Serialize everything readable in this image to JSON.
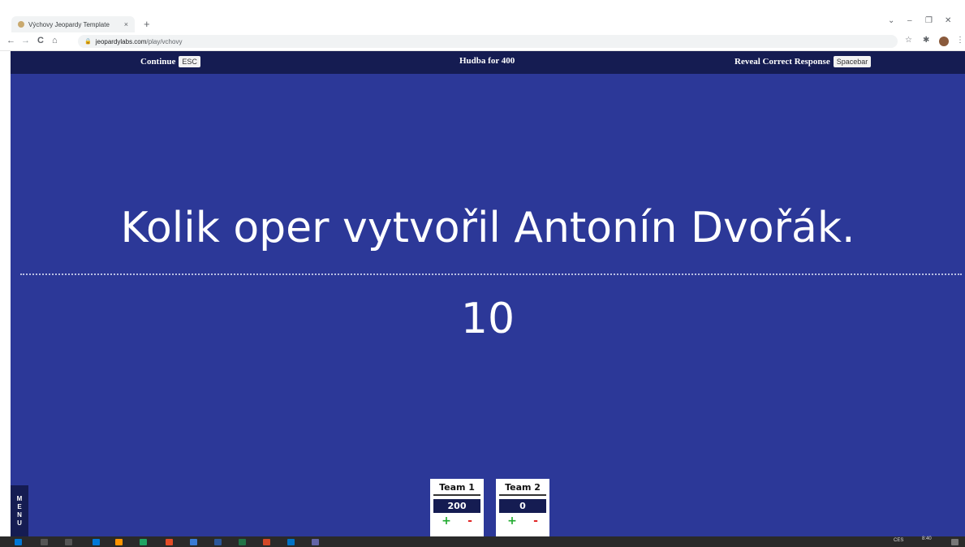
{
  "browser": {
    "tab_title": "Výchovy Jeopardy Template",
    "tab_close": "×",
    "new_tab": "+",
    "url_host": "jeopardylabs.com",
    "url_path": "/play/vchovy",
    "lock": "🔒",
    "back": "←",
    "forward": "→",
    "reload": "C",
    "home": "⌂",
    "star": "☆",
    "extensions": "✱",
    "more": "⋮",
    "window_controls": {
      "chevron": "⌄",
      "minimize": "–",
      "restore": "❐",
      "close": "✕"
    }
  },
  "game": {
    "continue_label": "Continue",
    "continue_key": "ESC",
    "category_title": "Hudba for 400",
    "reveal_label": "Reveal Correct Response",
    "reveal_key": "Spacebar",
    "question": "Kolik oper vytvořil Antonín Dvořák.",
    "answer": "10",
    "menu_letters": [
      "M",
      "E",
      "N",
      "U"
    ]
  },
  "teams": [
    {
      "name": "Team 1",
      "score": "200",
      "plus": "+",
      "minus": "-"
    },
    {
      "name": "Team 2",
      "score": "0",
      "plus": "+",
      "minus": "-"
    }
  ],
  "taskbar": {
    "time": "8:40",
    "lang": "CES",
    "icon_colors": [
      "#0078d7",
      "#ff9500",
      "#1fa463",
      "#e34c26",
      "#3a7bd5",
      "#2b579a",
      "#217346",
      "#d24726",
      "#0072c6",
      "#6264a7"
    ]
  },
  "colors": {
    "stage": "#2c3898",
    "topbar": "#151c52",
    "plus": "#1faa2e",
    "minus": "#e02525"
  }
}
